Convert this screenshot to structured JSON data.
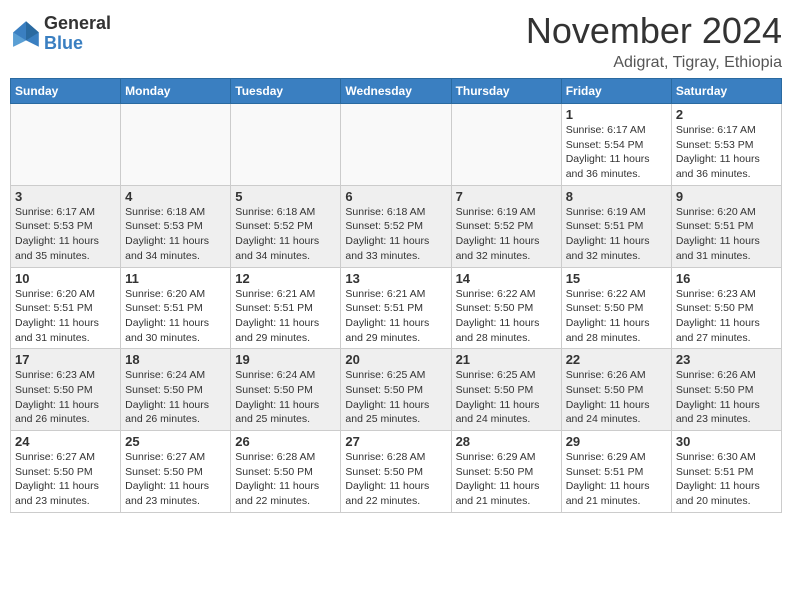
{
  "header": {
    "logo_general": "General",
    "logo_blue": "Blue",
    "month": "November 2024",
    "location": "Adigrat, Tigray, Ethiopia"
  },
  "weekdays": [
    "Sunday",
    "Monday",
    "Tuesday",
    "Wednesday",
    "Thursday",
    "Friday",
    "Saturday"
  ],
  "weeks": [
    [
      {
        "day": "",
        "info": ""
      },
      {
        "day": "",
        "info": ""
      },
      {
        "day": "",
        "info": ""
      },
      {
        "day": "",
        "info": ""
      },
      {
        "day": "",
        "info": ""
      },
      {
        "day": "1",
        "info": "Sunrise: 6:17 AM\nSunset: 5:54 PM\nDaylight: 11 hours\nand 36 minutes."
      },
      {
        "day": "2",
        "info": "Sunrise: 6:17 AM\nSunset: 5:53 PM\nDaylight: 11 hours\nand 36 minutes."
      }
    ],
    [
      {
        "day": "3",
        "info": "Sunrise: 6:17 AM\nSunset: 5:53 PM\nDaylight: 11 hours\nand 35 minutes."
      },
      {
        "day": "4",
        "info": "Sunrise: 6:18 AM\nSunset: 5:53 PM\nDaylight: 11 hours\nand 34 minutes."
      },
      {
        "day": "5",
        "info": "Sunrise: 6:18 AM\nSunset: 5:52 PM\nDaylight: 11 hours\nand 34 minutes."
      },
      {
        "day": "6",
        "info": "Sunrise: 6:18 AM\nSunset: 5:52 PM\nDaylight: 11 hours\nand 33 minutes."
      },
      {
        "day": "7",
        "info": "Sunrise: 6:19 AM\nSunset: 5:52 PM\nDaylight: 11 hours\nand 32 minutes."
      },
      {
        "day": "8",
        "info": "Sunrise: 6:19 AM\nSunset: 5:51 PM\nDaylight: 11 hours\nand 32 minutes."
      },
      {
        "day": "9",
        "info": "Sunrise: 6:20 AM\nSunset: 5:51 PM\nDaylight: 11 hours\nand 31 minutes."
      }
    ],
    [
      {
        "day": "10",
        "info": "Sunrise: 6:20 AM\nSunset: 5:51 PM\nDaylight: 11 hours\nand 31 minutes."
      },
      {
        "day": "11",
        "info": "Sunrise: 6:20 AM\nSunset: 5:51 PM\nDaylight: 11 hours\nand 30 minutes."
      },
      {
        "day": "12",
        "info": "Sunrise: 6:21 AM\nSunset: 5:51 PM\nDaylight: 11 hours\nand 29 minutes."
      },
      {
        "day": "13",
        "info": "Sunrise: 6:21 AM\nSunset: 5:51 PM\nDaylight: 11 hours\nand 29 minutes."
      },
      {
        "day": "14",
        "info": "Sunrise: 6:22 AM\nSunset: 5:50 PM\nDaylight: 11 hours\nand 28 minutes."
      },
      {
        "day": "15",
        "info": "Sunrise: 6:22 AM\nSunset: 5:50 PM\nDaylight: 11 hours\nand 28 minutes."
      },
      {
        "day": "16",
        "info": "Sunrise: 6:23 AM\nSunset: 5:50 PM\nDaylight: 11 hours\nand 27 minutes."
      }
    ],
    [
      {
        "day": "17",
        "info": "Sunrise: 6:23 AM\nSunset: 5:50 PM\nDaylight: 11 hours\nand 26 minutes."
      },
      {
        "day": "18",
        "info": "Sunrise: 6:24 AM\nSunset: 5:50 PM\nDaylight: 11 hours\nand 26 minutes."
      },
      {
        "day": "19",
        "info": "Sunrise: 6:24 AM\nSunset: 5:50 PM\nDaylight: 11 hours\nand 25 minutes."
      },
      {
        "day": "20",
        "info": "Sunrise: 6:25 AM\nSunset: 5:50 PM\nDaylight: 11 hours\nand 25 minutes."
      },
      {
        "day": "21",
        "info": "Sunrise: 6:25 AM\nSunset: 5:50 PM\nDaylight: 11 hours\nand 24 minutes."
      },
      {
        "day": "22",
        "info": "Sunrise: 6:26 AM\nSunset: 5:50 PM\nDaylight: 11 hours\nand 24 minutes."
      },
      {
        "day": "23",
        "info": "Sunrise: 6:26 AM\nSunset: 5:50 PM\nDaylight: 11 hours\nand 23 minutes."
      }
    ],
    [
      {
        "day": "24",
        "info": "Sunrise: 6:27 AM\nSunset: 5:50 PM\nDaylight: 11 hours\nand 23 minutes."
      },
      {
        "day": "25",
        "info": "Sunrise: 6:27 AM\nSunset: 5:50 PM\nDaylight: 11 hours\nand 23 minutes."
      },
      {
        "day": "26",
        "info": "Sunrise: 6:28 AM\nSunset: 5:50 PM\nDaylight: 11 hours\nand 22 minutes."
      },
      {
        "day": "27",
        "info": "Sunrise: 6:28 AM\nSunset: 5:50 PM\nDaylight: 11 hours\nand 22 minutes."
      },
      {
        "day": "28",
        "info": "Sunrise: 6:29 AM\nSunset: 5:50 PM\nDaylight: 11 hours\nand 21 minutes."
      },
      {
        "day": "29",
        "info": "Sunrise: 6:29 AM\nSunset: 5:51 PM\nDaylight: 11 hours\nand 21 minutes."
      },
      {
        "day": "30",
        "info": "Sunrise: 6:30 AM\nSunset: 5:51 PM\nDaylight: 11 hours\nand 20 minutes."
      }
    ]
  ]
}
